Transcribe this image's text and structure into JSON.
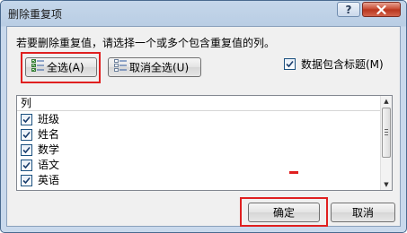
{
  "window": {
    "title": "删除重复项",
    "help_label": "?"
  },
  "instruction": "若要删除重复值，请选择一个或多个包含重复值的列。",
  "buttons": {
    "select_all": "全选(A)",
    "unselect_all": "取消全选(U)",
    "ok": "确定",
    "cancel": "取消"
  },
  "has_headers": {
    "label": "数据包含标题(M)",
    "checked": true
  },
  "column_list": {
    "header": "列",
    "items": [
      {
        "label": "班级",
        "checked": true
      },
      {
        "label": "姓名",
        "checked": true
      },
      {
        "label": "数学",
        "checked": true
      },
      {
        "label": "语文",
        "checked": true
      },
      {
        "label": "英语",
        "checked": true
      }
    ]
  },
  "colors": {
    "highlight": "#e02020",
    "title_bar": "#b9cde4",
    "close_button": "#c6462d"
  },
  "icons": [
    "help-icon",
    "close-icon",
    "select-all-icon",
    "unselect-all-icon",
    "checkbox-checked-icon",
    "scroll-up-icon",
    "scroll-down-icon"
  ]
}
